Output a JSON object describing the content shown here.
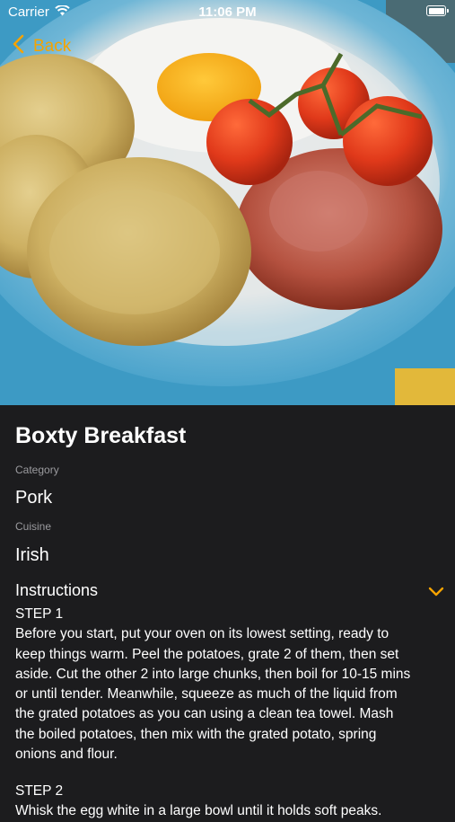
{
  "status_bar": {
    "carrier": "Carrier",
    "time": "11:06 PM"
  },
  "nav": {
    "back_label": "Back",
    "accent_color": "#f5a300"
  },
  "recipe": {
    "title": "Boxty Breakfast",
    "category_label": "Category",
    "category_value": "Pork",
    "cuisine_label": "Cuisine",
    "cuisine_value": "Irish"
  },
  "instructions": {
    "heading": "Instructions",
    "expand_icon": "chevron-down-icon",
    "steps": [
      {
        "title": "STEP 1",
        "lines": [
          "Before you start, put your oven on its lowest setting, ready to",
          "keep things warm. Peel the potatoes, grate 2 of them, then set",
          "aside. Cut the other 2 into large chunks, then boil for 10-15 mins",
          "or until tender. Meanwhile, squeeze as much of the liquid from",
          "the grated potatoes as you can using a clean tea towel. Mash",
          "the boiled potatoes, then mix with the grated potato, spring",
          "onions and flour."
        ]
      },
      {
        "title": "STEP 2",
        "lines": [
          "Whisk the egg white in a large bowl until it holds soft peaks."
        ]
      }
    ]
  }
}
